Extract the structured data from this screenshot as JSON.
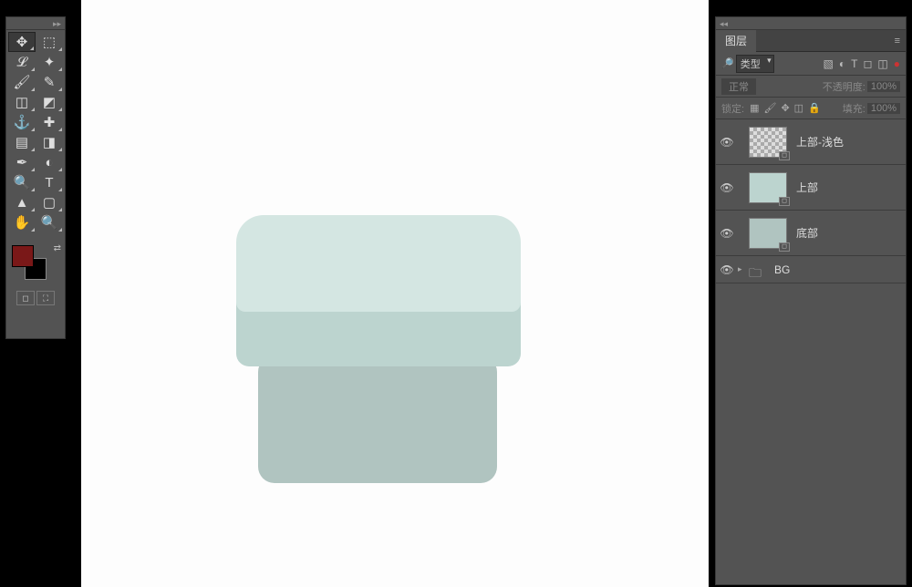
{
  "toolbox": {
    "tools": [
      {
        "name": "move",
        "glyph": "✥"
      },
      {
        "name": "marquee",
        "glyph": "⬚"
      },
      {
        "name": "lasso",
        "glyph": "𝓛"
      },
      {
        "name": "magic-wand",
        "glyph": "✦"
      },
      {
        "name": "brush",
        "glyph": "🖌"
      },
      {
        "name": "eyedropper",
        "glyph": "✎"
      },
      {
        "name": "crop",
        "glyph": "◫"
      },
      {
        "name": "slice",
        "glyph": "◩"
      },
      {
        "name": "stamp",
        "glyph": "⚓"
      },
      {
        "name": "healing",
        "glyph": "✚"
      },
      {
        "name": "gradient",
        "glyph": "▤"
      },
      {
        "name": "eraser",
        "glyph": "◨"
      },
      {
        "name": "pen",
        "glyph": "✒"
      },
      {
        "name": "blur",
        "glyph": "◐"
      },
      {
        "name": "dodge",
        "glyph": "🔍"
      },
      {
        "name": "type",
        "glyph": "T"
      },
      {
        "name": "path-select",
        "glyph": "▲"
      },
      {
        "name": "shape",
        "glyph": "▢"
      },
      {
        "name": "hand",
        "glyph": "✋"
      },
      {
        "name": "zoom",
        "glyph": "🔍"
      }
    ],
    "fg_color": "#7a1818",
    "bg_color": "#000000"
  },
  "layers_panel": {
    "title": "图层",
    "filter_label": "类型",
    "blend_mode": "正常",
    "opacity_label": "不透明度:",
    "opacity_value": "100%",
    "lock_label": "锁定:",
    "fill_label": "填充:",
    "fill_value": "100%",
    "layers": [
      {
        "name": "上部-浅色",
        "thumb": "checker",
        "type": "shape"
      },
      {
        "name": "上部",
        "thumb": "#bcd4cf",
        "type": "shape"
      },
      {
        "name": "底部",
        "thumb": "#b0c4c0",
        "type": "shape"
      },
      {
        "name": "BG",
        "thumb": "folder",
        "type": "group"
      }
    ]
  },
  "canvas": {
    "shapes": {
      "bottom_color": "#b0c4c0",
      "top_body_color": "#bcd4cf",
      "top_light_color": "#d4e6e2"
    }
  }
}
